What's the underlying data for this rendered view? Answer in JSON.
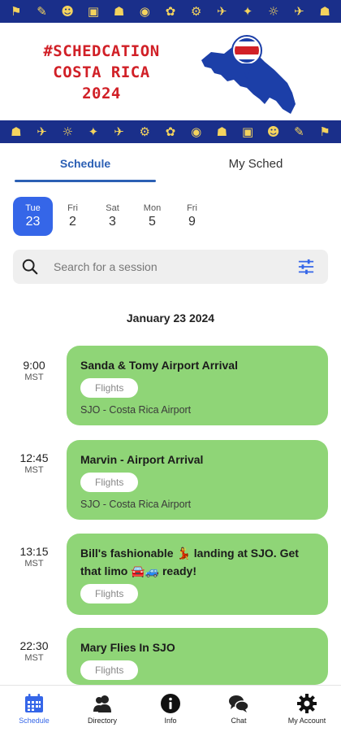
{
  "banner": {
    "title_line1": "#SCHEDCATION",
    "title_line2": "COSTA RICA",
    "title_line3": "2024",
    "strip_icons": [
      "⚑",
      "✎",
      "☻",
      "▣",
      "☗",
      "◉",
      "✿",
      "⚙",
      "✈",
      "✦",
      "☼",
      "✈",
      "☗"
    ],
    "colors": {
      "strip": "#1a2f8a",
      "title": "#d12027",
      "map": "#1c3fa8"
    }
  },
  "tabs": [
    {
      "label": "Schedule",
      "active": true
    },
    {
      "label": "My Sched",
      "active": false
    }
  ],
  "dates": [
    {
      "dow": "Tue",
      "day": "23",
      "selected": true
    },
    {
      "dow": "Fri",
      "day": "2",
      "selected": false
    },
    {
      "dow": "Sat",
      "day": "3",
      "selected": false
    },
    {
      "dow": "Mon",
      "day": "5",
      "selected": false
    },
    {
      "dow": "Fri",
      "day": "9",
      "selected": false
    }
  ],
  "search": {
    "placeholder": "Search for a session",
    "value": "",
    "icon": "search-icon",
    "filter_icon": "filter-icon"
  },
  "day_heading": "January 23 2024",
  "sessions": [
    {
      "time": "9:00",
      "tz": "MST",
      "title": "Sanda & Tomy Airport Arrival",
      "tag": "Flights",
      "location": "SJO - Costa Rica Airport"
    },
    {
      "time": "12:45",
      "tz": "MST",
      "title": "Marvin - Airport Arrival",
      "tag": "Flights",
      "location": "SJO - Costa Rica Airport"
    },
    {
      "time": "13:15",
      "tz": "MST",
      "title": "Bill's fashionable 💃 landing at SJO. Get that limo 🚘🚙 ready!",
      "tag": "Flights",
      "location": ""
    },
    {
      "time": "22:30",
      "tz": "MST",
      "title": "Mary Flies In SJO",
      "tag": "Flights",
      "location": ""
    }
  ],
  "nav": [
    {
      "label": "Schedule",
      "icon": "calendar-icon",
      "active": true
    },
    {
      "label": "Directory",
      "icon": "people-icon",
      "active": false
    },
    {
      "label": "Info",
      "icon": "info-icon",
      "active": false
    },
    {
      "label": "Chat",
      "icon": "chat-icon",
      "active": false
    },
    {
      "label": "My Account",
      "icon": "gear-icon",
      "active": false
    }
  ],
  "colors": {
    "accent": "#3566e8",
    "card": "#8fd577"
  }
}
